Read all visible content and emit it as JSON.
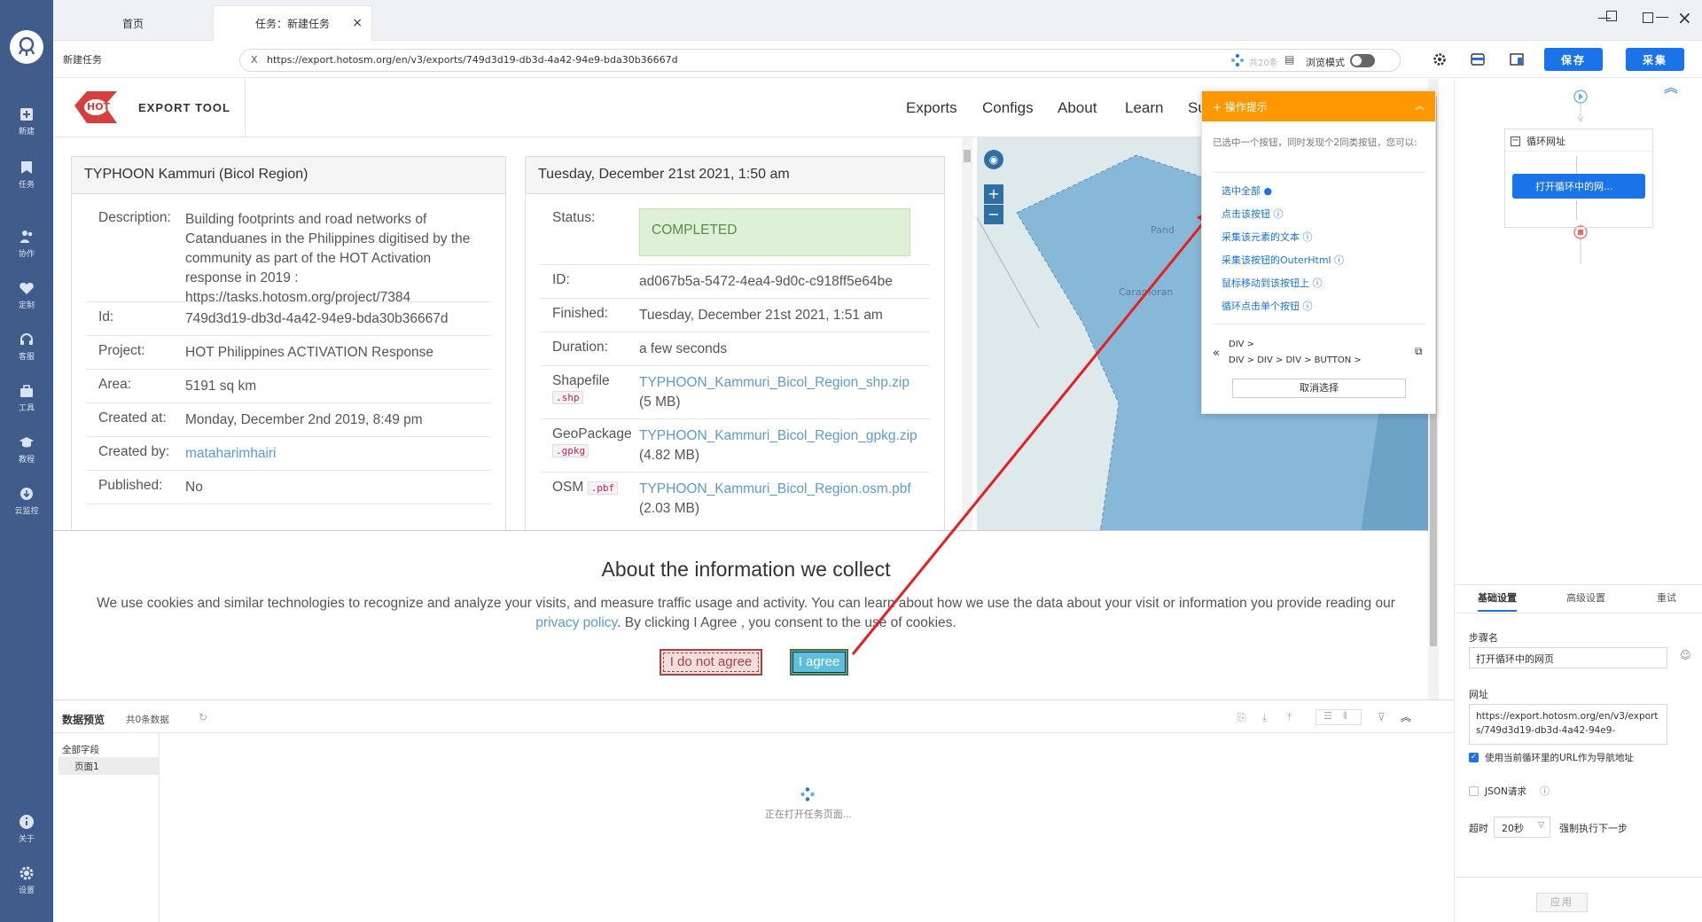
{
  "tabs": [
    {
      "label": "首页"
    },
    {
      "label": "任务：新建任务"
    }
  ],
  "window_controls": {
    "close": "×"
  },
  "address_bar": {
    "page_label": "新建任务",
    "url": "https://export.hotosm.org/en/v3/exports/749d3d19-db3d-4a42-94e9-bda30b36667d",
    "count_label": "共20条",
    "browse_mode_label": "浏览模式",
    "save_label": "保存",
    "collect_label": "采集"
  },
  "sidebar": {
    "items": [
      {
        "label": "新建",
        "icon": "plus-square-icon"
      },
      {
        "label": "任务",
        "icon": "bookmark-icon"
      },
      {
        "label": "协作",
        "icon": "users-icon"
      },
      {
        "label": "定制",
        "icon": "heart-icon"
      },
      {
        "label": "客服",
        "icon": "headset-icon"
      },
      {
        "label": "工具",
        "icon": "toolbox-icon"
      },
      {
        "label": "教程",
        "icon": "graduation-icon"
      },
      {
        "label": "云监控",
        "icon": "cloud-icon"
      },
      {
        "label": "关于",
        "icon": "info-icon"
      },
      {
        "label": "设置",
        "icon": "gear-icon"
      }
    ]
  },
  "site": {
    "brand": "EXPORT TOOL",
    "logo_text": "HOT",
    "nav": [
      {
        "label": "Exports"
      },
      {
        "label": "Configs"
      },
      {
        "label": "About"
      },
      {
        "label": "Learn"
      },
      {
        "label": "Su"
      }
    ]
  },
  "details": {
    "title": "TYPHOON Kammuri (Bicol Region)",
    "description_label": "Description:",
    "description": "Building footprints and road networks of Catanduanes in the Philippines digitised by the community as part of the HOT Activation response in 2019 : https://tasks.hotosm.org/project/7384",
    "id_label": "Id:",
    "id": "749d3d19-db3d-4a42-94e9-bda30b36667d",
    "project_label": "Project:",
    "project": "HOT Philippines ACTIVATION Response",
    "area_label": "Area:",
    "area": "5191 sq km",
    "created_at_label": "Created at:",
    "created_at": "Monday, December 2nd 2019, 8:49 pm",
    "created_by_label": "Created by:",
    "created_by": "mataharimhairi",
    "published_label": "Published:",
    "published": "No"
  },
  "run": {
    "title": "Tuesday, December 21st 2021, 1:50 am",
    "status_label": "Status:",
    "status": "COMPLETED",
    "id_label": "ID:",
    "id": "ad067b5a-5472-4ea4-9d0c-c918ff5e64be",
    "finished_label": "Finished:",
    "finished": "Tuesday, December 21st 2021, 1:51 am",
    "duration_label": "Duration:",
    "duration": "a few seconds",
    "files": [
      {
        "format": "Shapefile",
        "ext": ".shp",
        "name": "TYPHOON_Kammuri_Bicol_Region_shp.zip",
        "size": "(5 MB)"
      },
      {
        "format": "GeoPackage",
        "ext": ".gpkg",
        "name": "TYPHOON_Kammuri_Bicol_Region_gpkg.zip",
        "size": "(4.82 MB)"
      },
      {
        "format": "OSM",
        "ext": ".pbf",
        "name": "TYPHOON_Kammuri_Bicol_Region.osm.pbf",
        "size": "(2.03 MB)"
      }
    ]
  },
  "map": {
    "zoom_in": "+",
    "zoom_out": "−",
    "place1": "Pand",
    "place2": "Caramoran"
  },
  "cookie": {
    "title": "About the information we collect",
    "text_before": "We use cookies and similar technologies to recognize and analyze your visits, and measure traffic usage and activity. You can learn about how we use the data about your visit or information you provide reading our ",
    "policy_link": "privacy policy",
    "text_after": ". By clicking I Agree , you consent to the use of cookies.",
    "disagree_label": "I do not agree",
    "agree_label": "I agree"
  },
  "popup": {
    "title": "+ 操作提示",
    "message": "已选中一个按钮，同时发现个2同类按钮，您可以:",
    "options": [
      {
        "label": "选中全部"
      },
      {
        "label": "点击该按钮"
      },
      {
        "label": "采集该元素的文本"
      },
      {
        "label": "采集该按钮的OuterHtml"
      },
      {
        "label": "鼠标移动到该按钮上"
      },
      {
        "label": "循环点击单个按钮"
      }
    ],
    "path_line1": "DIV >",
    "path_line2": "DIV > DIV > DIV > BUTTON >",
    "cancel_label": "取消选择"
  },
  "workflow": {
    "loop_label": "循环网址",
    "step_label": "打开循环中的网..."
  },
  "settings": {
    "tabs": [
      {
        "label": "基础设置"
      },
      {
        "label": "高级设置"
      },
      {
        "label": "重试"
      }
    ],
    "step_name_label": "步骤名",
    "step_name_value": "打开循环中的网页",
    "url_label": "网址",
    "url_value": "https://export.hotosm.org/en/v3/exports/749d3d19-db3d-4a42-94e9-",
    "use_loop_url_label": "使用当前循环里的URL作为导航地址",
    "json_label": "JSON请求",
    "timeout_label": "超时",
    "timeout_value": "20秒",
    "force_label": "强制执行下一步",
    "apply_label": "应用"
  },
  "preview": {
    "title": "数据预览",
    "count": "共0条数据",
    "all_fields": "全部字段",
    "page1": "页面1",
    "loading": "正在打开任务页面..."
  },
  "colors": {
    "sidebar": "#3f5c8a",
    "accent": "#1a73e8",
    "orange": "#ff9800",
    "hot_red": "#d73f3f",
    "map_water": "#7fb3d5"
  }
}
